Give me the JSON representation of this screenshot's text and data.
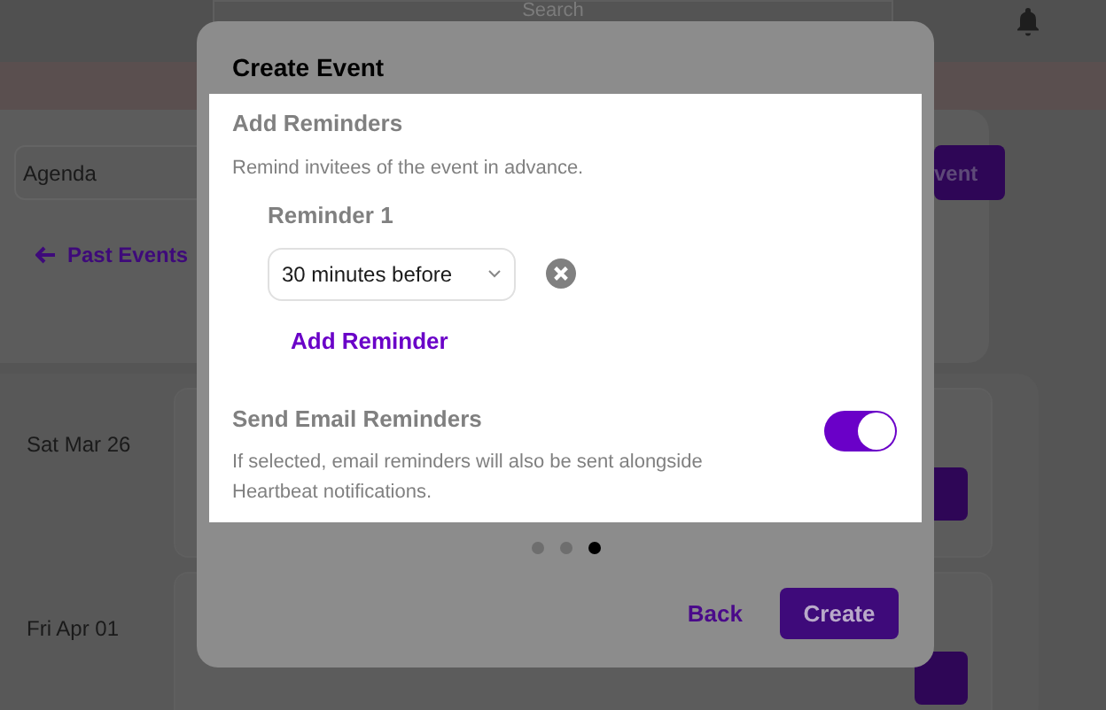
{
  "header": {
    "search": {
      "placeholder": "Search"
    }
  },
  "toolbar": {
    "view_select": "Agenda",
    "past_events_link": "Past Events",
    "create_button": "vent"
  },
  "agenda": [
    {
      "date": "Sat Mar 26"
    },
    {
      "date": "Fri Apr 01"
    }
  ],
  "modal": {
    "title": "Create Event",
    "section_title": "Add Reminders",
    "section_hint": "Remind invitees of the event in advance.",
    "reminders": [
      {
        "label": "Reminder 1",
        "value": "30 minutes before"
      }
    ],
    "add_reminder": "Add Reminder",
    "email": {
      "title": "Send Email Reminders",
      "hint": "If selected, email reminders will also be sent alongside Heartbeat notifications.",
      "on": true
    },
    "steps": [
      {
        "selected": false
      },
      {
        "selected": false
      },
      {
        "selected": true
      }
    ],
    "buttons": {
      "back": "Back",
      "create": "Create"
    }
  }
}
